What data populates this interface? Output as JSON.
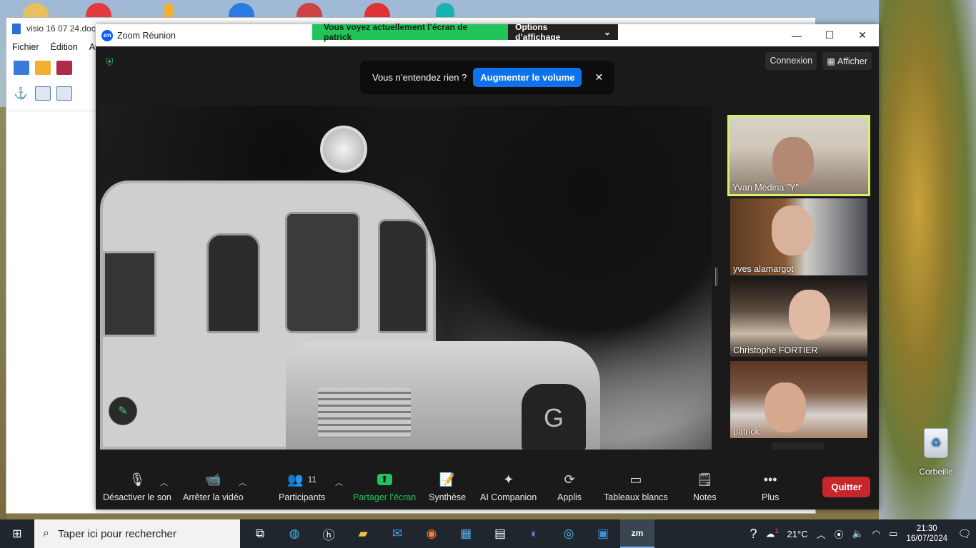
{
  "doc_window": {
    "title": "visio 16 07 24.doc",
    "menu": [
      "Fichier",
      "Édition",
      "Af"
    ]
  },
  "zoom": {
    "title": "Zoom Réunion",
    "share_banner": "Vous voyez actuellement l’écran de patrick",
    "view_options": "Options d’affichage",
    "top_buttons": {
      "connexion": "Connexion",
      "afficher": "Afficher"
    },
    "toast": {
      "text": "Vous n’entendez rien ?",
      "button": "Augmenter le volume"
    },
    "participants_tiles": [
      {
        "name": "Yvan Médina  \"Y\""
      },
      {
        "name": "yves alamargot"
      },
      {
        "name": "Christophe FORTIER"
      },
      {
        "name": "patrick"
      }
    ],
    "toolbar": {
      "mute": "Désactiver le son",
      "video": "Arrêter la vidéo",
      "participants": "Participants",
      "participants_count": "11",
      "share": "Partager l’écran",
      "summary": "Synthèse",
      "ai": "AI Companion",
      "apps": "Applis",
      "whiteboards": "Tableaux blancs",
      "notes": "Notes",
      "more": "Plus",
      "quit": "Quitter"
    },
    "shared_screen_plate": "G"
  },
  "desktop": {
    "recycle_bin": "Corbeille"
  },
  "taskbar": {
    "search_placeholder": "Taper ici pour rechercher",
    "weather": "21°C",
    "weather_badge": "1",
    "time": "21:30",
    "date": "16/07/2024"
  },
  "colors": {
    "zoom_blue": "#0e72ed",
    "share_green": "#23c25a",
    "quit_red": "#c7262b",
    "active_speaker": "#d7f06c"
  }
}
